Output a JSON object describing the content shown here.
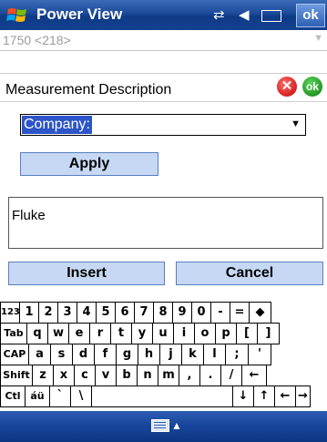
{
  "titlebar": {
    "title": "Power View",
    "ok_label": "ok",
    "icons": [
      "windows-start-icon",
      "connectivity-icon",
      "volume-icon",
      "battery-icon"
    ]
  },
  "device_combo": {
    "value": "1750 <218>"
  },
  "form": {
    "description_label": "Measurement Description",
    "field_select": {
      "selected": "Company:"
    },
    "apply_label": "Apply",
    "text_value": "Fluke",
    "insert_label": "Insert",
    "cancel_label": "Cancel"
  },
  "keyboard": {
    "rows": [
      [
        "123",
        "1",
        "2",
        "3",
        "4",
        "5",
        "6",
        "7",
        "8",
        "9",
        "0",
        "-",
        "=",
        "◆"
      ],
      [
        "Tab",
        "q",
        "w",
        "e",
        "r",
        "t",
        "y",
        "u",
        "i",
        "o",
        "p",
        "[",
        "]"
      ],
      [
        "CAP",
        "a",
        "s",
        "d",
        "f",
        "g",
        "h",
        "j",
        "k",
        "l",
        ";",
        "'"
      ],
      [
        "Shift",
        "z",
        "x",
        "c",
        "v",
        "b",
        "n",
        "m",
        ",",
        ".",
        "/",
        "←"
      ],
      [
        "Ctl",
        "áü",
        "`",
        "\\",
        " ",
        "↓",
        "↑",
        "←",
        "→"
      ]
    ]
  },
  "colors": {
    "titlebar": "#1c4a9a",
    "button_bg": "#c6d8f3",
    "selection": "#2d55c8"
  }
}
